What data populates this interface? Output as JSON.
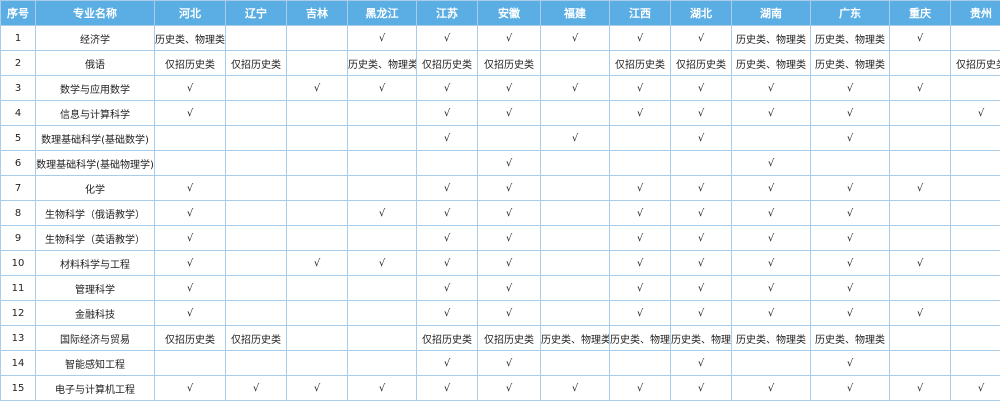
{
  "table": {
    "headers": [
      "序号",
      "专业名称",
      "河北",
      "辽宁",
      "吉林",
      "黑龙江",
      "江苏",
      "安徽",
      "福建",
      "江西",
      "湖北",
      "湖南",
      "广东",
      "重庆",
      "贵州"
    ],
    "rows": [
      [
        "1",
        "经济学",
        "历史类、物理类",
        "",
        "",
        "√",
        "√",
        "√",
        "√",
        "√",
        "√",
        "历史类、物理类",
        "历史类、物理类",
        "√",
        ""
      ],
      [
        "2",
        "俄语",
        "仅招历史类",
        "仅招历史类",
        "",
        "历史类、物理类",
        "仅招历史类",
        "仅招历史类",
        "",
        "仅招历史类",
        "仅招历史类",
        "历史类、物理类",
        "历史类、物理类",
        "",
        "仅招历史类"
      ],
      [
        "3",
        "数学与应用数学",
        "√",
        "",
        "√",
        "√",
        "√",
        "√",
        "√",
        "√",
        "√",
        "√",
        "√",
        "√",
        ""
      ],
      [
        "4",
        "信息与计算科学",
        "√",
        "",
        "",
        "",
        "√",
        "√",
        "",
        "√",
        "√",
        "√",
        "√",
        "",
        "√"
      ],
      [
        "5",
        "数理基础科学(基础数学)",
        "",
        "",
        "",
        "",
        "√",
        "",
        "√",
        "",
        "√",
        "",
        "√",
        "",
        ""
      ],
      [
        "6",
        "数理基础科学(基础物理学)",
        "",
        "",
        "",
        "",
        "",
        "√",
        "",
        "",
        "",
        "√",
        "",
        "",
        ""
      ],
      [
        "7",
        "化学",
        "√",
        "",
        "",
        "",
        "√",
        "√",
        "",
        "√",
        "√",
        "√",
        "√",
        "√",
        ""
      ],
      [
        "8",
        "生物科学（俄语教学）",
        "√",
        "",
        "",
        "√",
        "√",
        "√",
        "",
        "√",
        "√",
        "√",
        "√",
        "",
        ""
      ],
      [
        "9",
        "生物科学（英语教学）",
        "√",
        "",
        "",
        "",
        "√",
        "√",
        "",
        "√",
        "√",
        "√",
        "√",
        "",
        ""
      ],
      [
        "10",
        "材料科学与工程",
        "√",
        "",
        "√",
        "√",
        "√",
        "√",
        "",
        "√",
        "√",
        "√",
        "√",
        "√",
        ""
      ],
      [
        "11",
        "管理科学",
        "√",
        "",
        "",
        "",
        "√",
        "√",
        "",
        "√",
        "√",
        "√",
        "√",
        "",
        ""
      ],
      [
        "12",
        "金融科技",
        "√",
        "",
        "",
        "",
        "√",
        "√",
        "",
        "√",
        "√",
        "√",
        "√",
        "√",
        ""
      ],
      [
        "13",
        "国际经济与贸易",
        "仅招历史类",
        "仅招历史类",
        "",
        "",
        "仅招历史类",
        "仅招历史类",
        "历史类、物理类",
        "历史类、物理类",
        "历史类、物理类",
        "历史类、物理类",
        "历史类、物理类",
        "",
        ""
      ],
      [
        "14",
        "智能感知工程",
        "",
        "",
        "",
        "",
        "√",
        "√",
        "",
        "",
        "√",
        "",
        "√",
        "",
        ""
      ],
      [
        "15",
        "电子与计算机工程",
        "√",
        "√",
        "√",
        "√",
        "√",
        "√",
        "√",
        "√",
        "√",
        "√",
        "√",
        "√",
        "√"
      ]
    ]
  }
}
